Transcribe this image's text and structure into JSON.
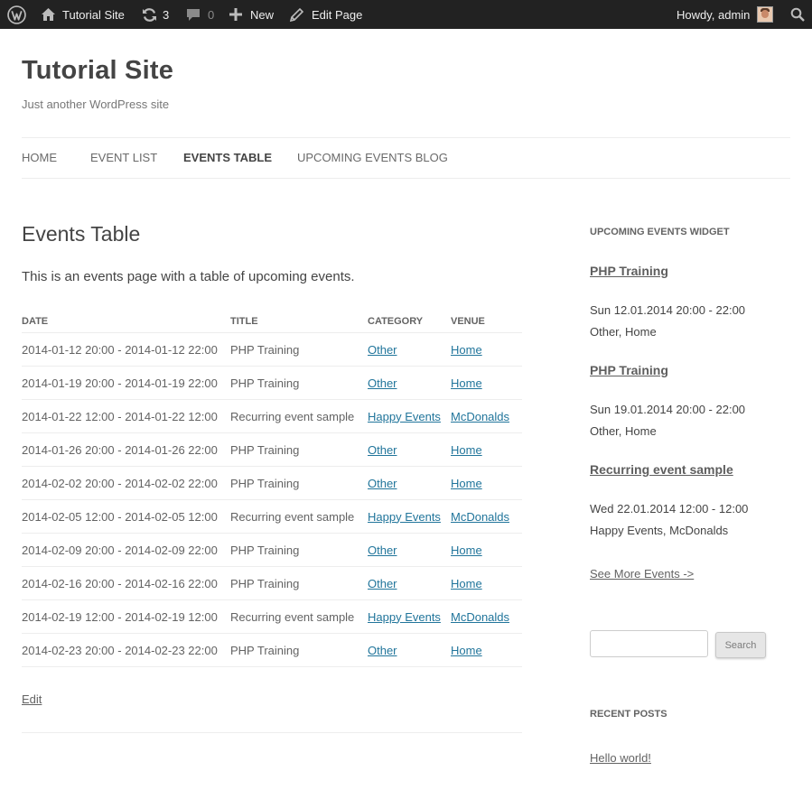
{
  "adminbar": {
    "site_name": "Tutorial Site",
    "updates_count": "3",
    "comments_count": "0",
    "new_label": "New",
    "edit_page_label": "Edit Page",
    "greeting": "Howdy, admin"
  },
  "site": {
    "title": "Tutorial Site",
    "description": "Just another WordPress site"
  },
  "nav": {
    "items": [
      {
        "label": "HOME"
      },
      {
        "label": "EVENT LIST"
      },
      {
        "label": "EVENTS TABLE"
      },
      {
        "label": "UPCOMING EVENTS BLOG"
      }
    ]
  },
  "page": {
    "title": "Events Table",
    "intro": "This is an events page with a table of upcoming events.",
    "edit_label": "Edit"
  },
  "table": {
    "headers": {
      "date": "DATE",
      "title": "TITLE",
      "category": "CATEGORY",
      "venue": "VENUE"
    },
    "rows": [
      {
        "date": "2014-01-12 20:00 - 2014-01-12 22:00",
        "title": "PHP Training",
        "category": "Other",
        "venue": "Home"
      },
      {
        "date": "2014-01-19 20:00 - 2014-01-19 22:00",
        "title": "PHP Training",
        "category": "Other",
        "venue": "Home"
      },
      {
        "date": "2014-01-22 12:00 - 2014-01-22 12:00",
        "title": "Recurring event sample",
        "category": "Happy Events",
        "venue": "McDonalds"
      },
      {
        "date": "2014-01-26 20:00 - 2014-01-26 22:00",
        "title": "PHP Training",
        "category": "Other",
        "venue": "Home"
      },
      {
        "date": "2014-02-02 20:00 - 2014-02-02 22:00",
        "title": "PHP Training",
        "category": "Other",
        "venue": "Home"
      },
      {
        "date": "2014-02-05 12:00 - 2014-02-05 12:00",
        "title": "Recurring event sample",
        "category": "Happy Events",
        "venue": "McDonalds"
      },
      {
        "date": "2014-02-09 20:00 - 2014-02-09 22:00",
        "title": "PHP Training",
        "category": "Other",
        "venue": "Home"
      },
      {
        "date": "2014-02-16 20:00 - 2014-02-16 22:00",
        "title": "PHP Training",
        "category": "Other",
        "venue": "Home"
      },
      {
        "date": "2014-02-19 12:00 - 2014-02-19 12:00",
        "title": "Recurring event sample",
        "category": "Happy Events",
        "venue": "McDonalds"
      },
      {
        "date": "2014-02-23 20:00 - 2014-02-23 22:00",
        "title": "PHP Training",
        "category": "Other",
        "venue": "Home"
      }
    ]
  },
  "sidebar": {
    "widget_title": "UPCOMING EVENTS WIDGET",
    "events": [
      {
        "title": "PHP Training",
        "datetime": "Sun 12.01.2014 20:00 - 22:00",
        "meta": "Other, Home"
      },
      {
        "title": "PHP Training",
        "datetime": "Sun 19.01.2014 20:00 - 22:00",
        "meta": "Other, Home"
      },
      {
        "title": "Recurring event sample",
        "datetime": "Wed 22.01.2014 12:00 - 12:00",
        "meta": "Happy Events, McDonalds"
      }
    ],
    "see_more_label": "See More Events ->",
    "search": {
      "value": "",
      "placeholder": "",
      "button_label": "Search"
    },
    "recent_posts_title": "RECENT POSTS",
    "recent_posts": [
      {
        "title": "Hello world!"
      }
    ]
  },
  "colors": {
    "adminbar_bg": "#222222",
    "link": "#21759b",
    "text": "#444444",
    "muted_text": "#636363",
    "border": "#ededed"
  },
  "icons": [
    "wordpress-logo-icon",
    "home-icon",
    "refresh-icon",
    "comment-icon",
    "plus-icon",
    "pencil-icon",
    "search-icon"
  ]
}
